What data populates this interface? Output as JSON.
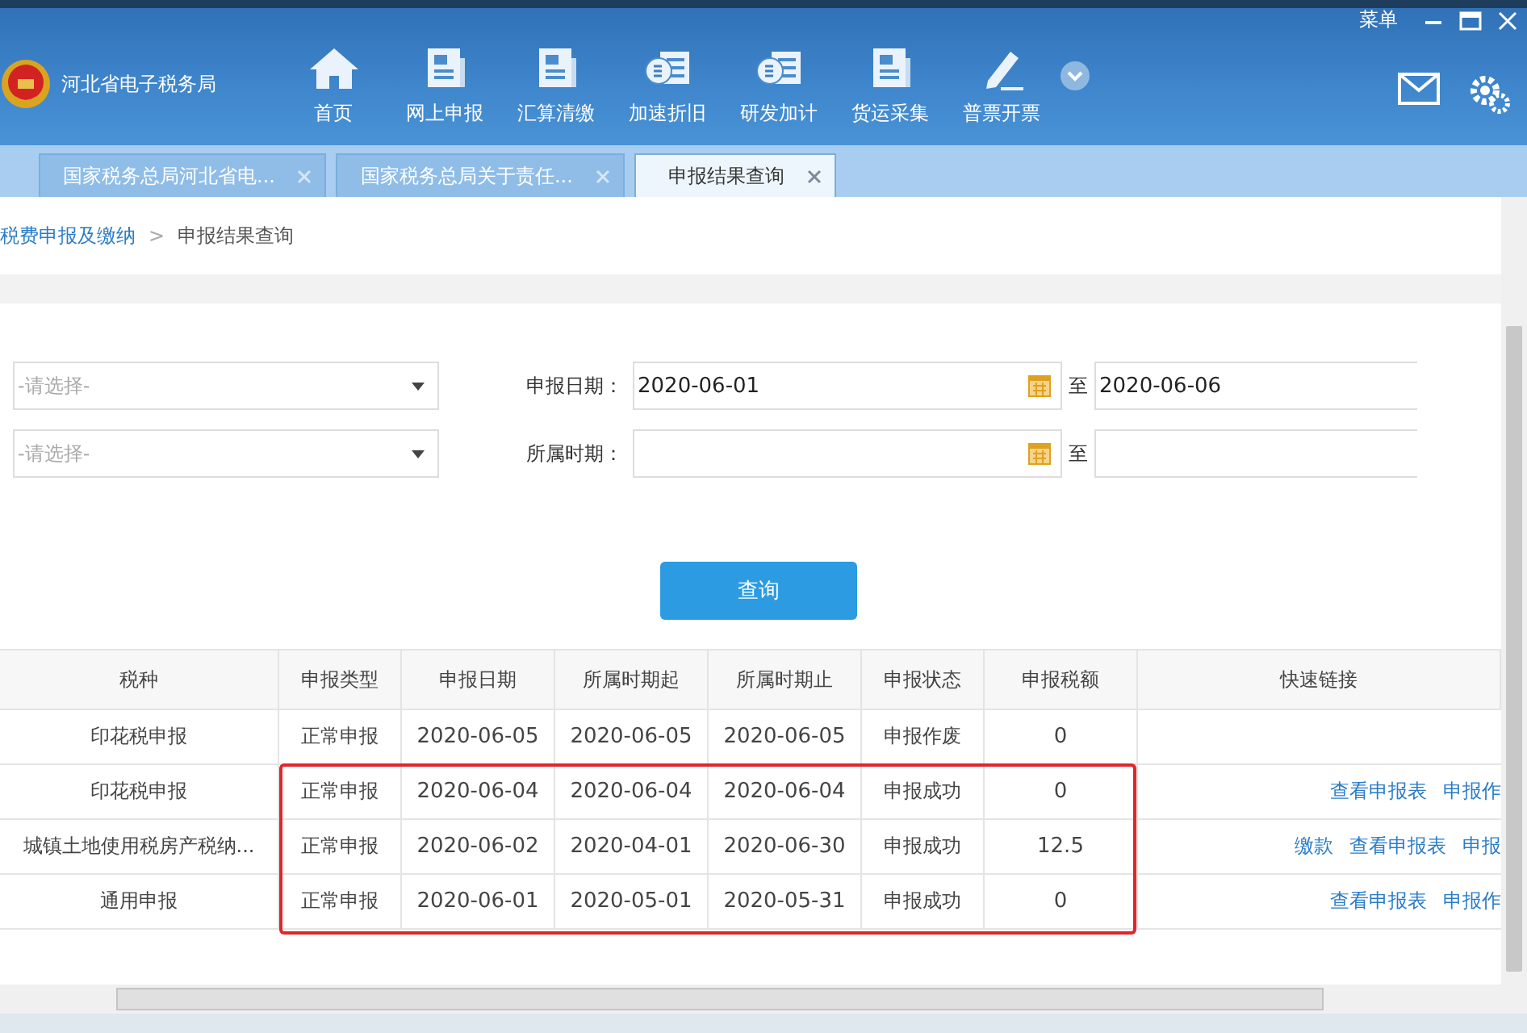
{
  "window": {
    "title": "河北省电子税务局",
    "menu_label": "菜单"
  },
  "nav": [
    {
      "label": "首页",
      "kind": "home"
    },
    {
      "label": "网上申报",
      "kind": "doc"
    },
    {
      "label": "汇算清缴",
      "kind": "doc"
    },
    {
      "label": "加速折旧",
      "kind": "money"
    },
    {
      "label": "研发加计",
      "kind": "money"
    },
    {
      "label": "货运采集",
      "kind": "doc"
    },
    {
      "label": "普票开票",
      "kind": "pen"
    }
  ],
  "tabs": [
    {
      "label": "国家税务总局河北省电...",
      "selected": false
    },
    {
      "label": "国家税务总局关于责任...",
      "selected": false
    },
    {
      "label": "申报结果查询",
      "selected": true
    }
  ],
  "breadcrumb": {
    "link": "税费申报及缴纳",
    "separator": ">",
    "current": "申报结果查询"
  },
  "form": {
    "selects": [
      {
        "placeholder": "-请选择-"
      },
      {
        "placeholder": "-请选择-"
      }
    ],
    "date_rows": [
      {
        "label": "申报日期：",
        "start": "2020-06-01",
        "to": "至",
        "end": "2020-06-06"
      },
      {
        "label": "所属时期：",
        "to": "至"
      }
    ],
    "button": "查询"
  },
  "table": {
    "columns": [
      "税种",
      "申报类型",
      "申报日期",
      "所属时期起",
      "所属时期止",
      "申报状态",
      "申报税额",
      "快速链接"
    ],
    "rows": [
      {
        "cells": [
          "印花税申报",
          "正常申报",
          "2020-06-05",
          "2020-06-05",
          "2020-06-05",
          "申报作废",
          "0"
        ],
        "links": [],
        "highlighted": false
      },
      {
        "cells": [
          "印花税申报",
          "正常申报",
          "2020-06-04",
          "2020-06-04",
          "2020-06-04",
          "申报成功",
          "0"
        ],
        "links": [
          "查看申报表",
          "申报作"
        ],
        "highlighted": true
      },
      {
        "cells": [
          "城镇土地使用税房产税纳...",
          "正常申报",
          "2020-06-02",
          "2020-04-01",
          "2020-06-30",
          "申报成功",
          "12.5"
        ],
        "links": [
          "缴款",
          "查看申报表",
          "申报"
        ],
        "highlighted": true
      },
      {
        "cells": [
          "通用申报",
          "正常申报",
          "2020-06-01",
          "2020-05-01",
          "2020-05-31",
          "申报成功",
          "0"
        ],
        "links": [
          "查看申报表",
          "申报作"
        ],
        "highlighted": true
      }
    ]
  }
}
